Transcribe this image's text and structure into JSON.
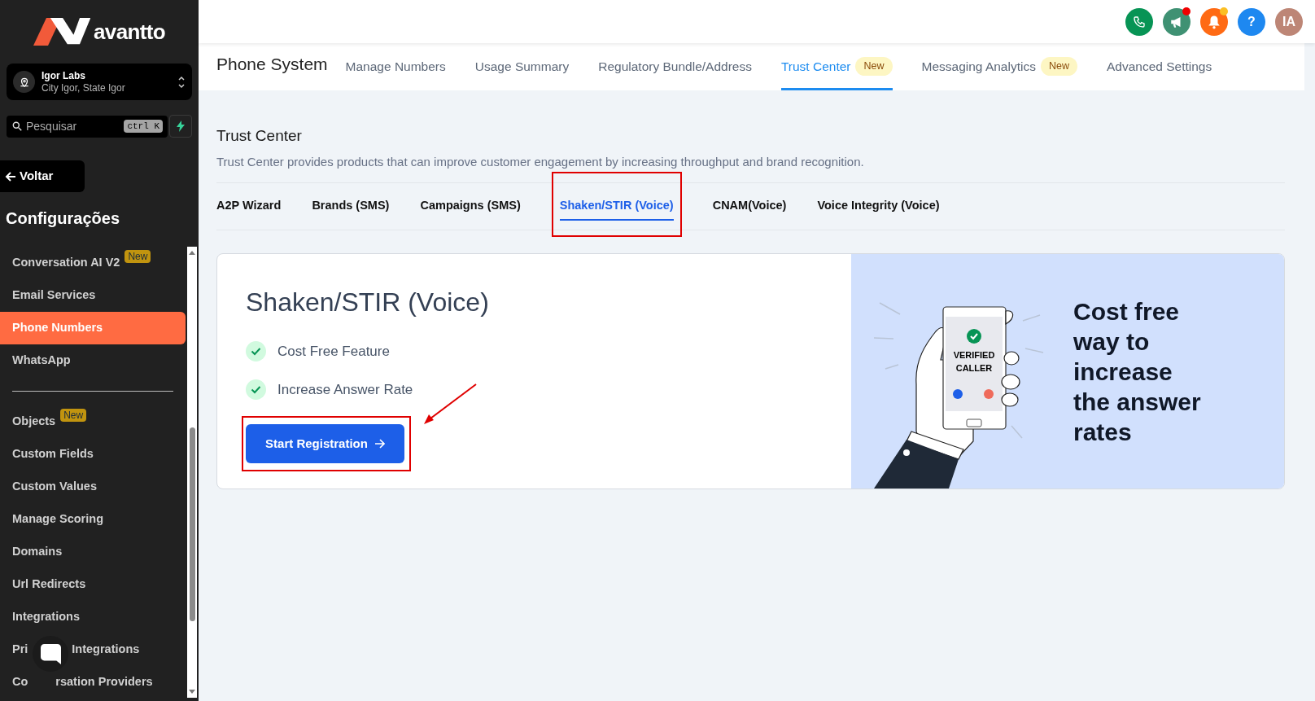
{
  "brand": {
    "name": "avantto"
  },
  "location": {
    "name": "Igor Labs",
    "address": "City Igor, State Igor"
  },
  "search": {
    "placeholder": "Pesquisar",
    "shortcut": "ctrl K"
  },
  "back_button": {
    "label": "Voltar"
  },
  "sidebar": {
    "title": "Configurações",
    "groups": [
      [
        {
          "parts": [
            "Conversation AI V2"
          ],
          "badge": "New",
          "selected": false
        },
        {
          "parts": [
            "Email Services"
          ],
          "selected": false
        },
        {
          "parts": [
            "Phone Numbers"
          ],
          "selected": true
        },
        {
          "parts": [
            "WhatsApp"
          ],
          "selected": false
        }
      ],
      [
        {
          "parts": [
            "Objects"
          ],
          "badge": "New",
          "selected": false
        },
        {
          "parts": [
            "Custom Fields"
          ],
          "selected": false
        },
        {
          "parts": [
            "Custom Values"
          ],
          "selected": false
        },
        {
          "parts": [
            "Manage Scoring"
          ],
          "selected": false
        },
        {
          "parts": [
            "Domains"
          ],
          "selected": false
        },
        {
          "parts": [
            "Url Redirects"
          ],
          "selected": false
        },
        {
          "parts": [
            "Integrations"
          ],
          "selected": false
        },
        {
          "parts": [
            "Pri",
            "Integrations"
          ],
          "selected": false
        },
        {
          "parts": [
            "Co",
            "rsation Providers"
          ],
          "selected": false
        }
      ]
    ]
  },
  "header": {
    "actions": [
      {
        "kind": "phone",
        "color": "#079455"
      },
      {
        "kind": "announcements",
        "color": "#3f9173",
        "unread": true
      },
      {
        "kind": "notifications",
        "color": "#ff6a14",
        "unread": true
      },
      {
        "kind": "help",
        "color": "#1e88f0",
        "text": "?"
      },
      {
        "kind": "avatar",
        "color": "#bd8676",
        "text": "IA"
      }
    ]
  },
  "section_title": "Phone System",
  "nav_tabs": [
    {
      "label": "Manage Numbers",
      "selected": false
    },
    {
      "label": "Usage Summary",
      "selected": false
    },
    {
      "label": "Regulatory Bundle/Address",
      "selected": false
    },
    {
      "label": "Trust Center",
      "badge": "New",
      "selected": true
    },
    {
      "label": "Messaging Analytics",
      "badge": "New",
      "selected": false
    },
    {
      "label": "Advanced Settings",
      "selected": false
    }
  ],
  "page": {
    "title": "Trust Center",
    "description": "Trust Center provides products that can improve customer engagement by increasing throughput and brand recognition."
  },
  "sub_tabs": [
    {
      "label": "A2P Wizard",
      "selected": false,
      "highlighted": false
    },
    {
      "label": "Brands (SMS)",
      "selected": false,
      "highlighted": false
    },
    {
      "label": "Campaigns (SMS)",
      "selected": false,
      "highlighted": false
    },
    {
      "label": "Shaken/STIR (Voice)",
      "selected": true,
      "highlighted": true
    },
    {
      "label": "CNAM(Voice)",
      "selected": false,
      "highlighted": false
    },
    {
      "label": "Voice Integrity (Voice)",
      "selected": false,
      "highlighted": false
    }
  ],
  "card": {
    "title": "Shaken/STIR (Voice)",
    "features": [
      "Cost Free Feature",
      "Increase Answer Rate"
    ],
    "button": {
      "label": "Start Registration",
      "highlighted": true
    },
    "illustration_caption": "VERIFIED CALLER",
    "promo": "Cost free way to increase the answer rates"
  }
}
